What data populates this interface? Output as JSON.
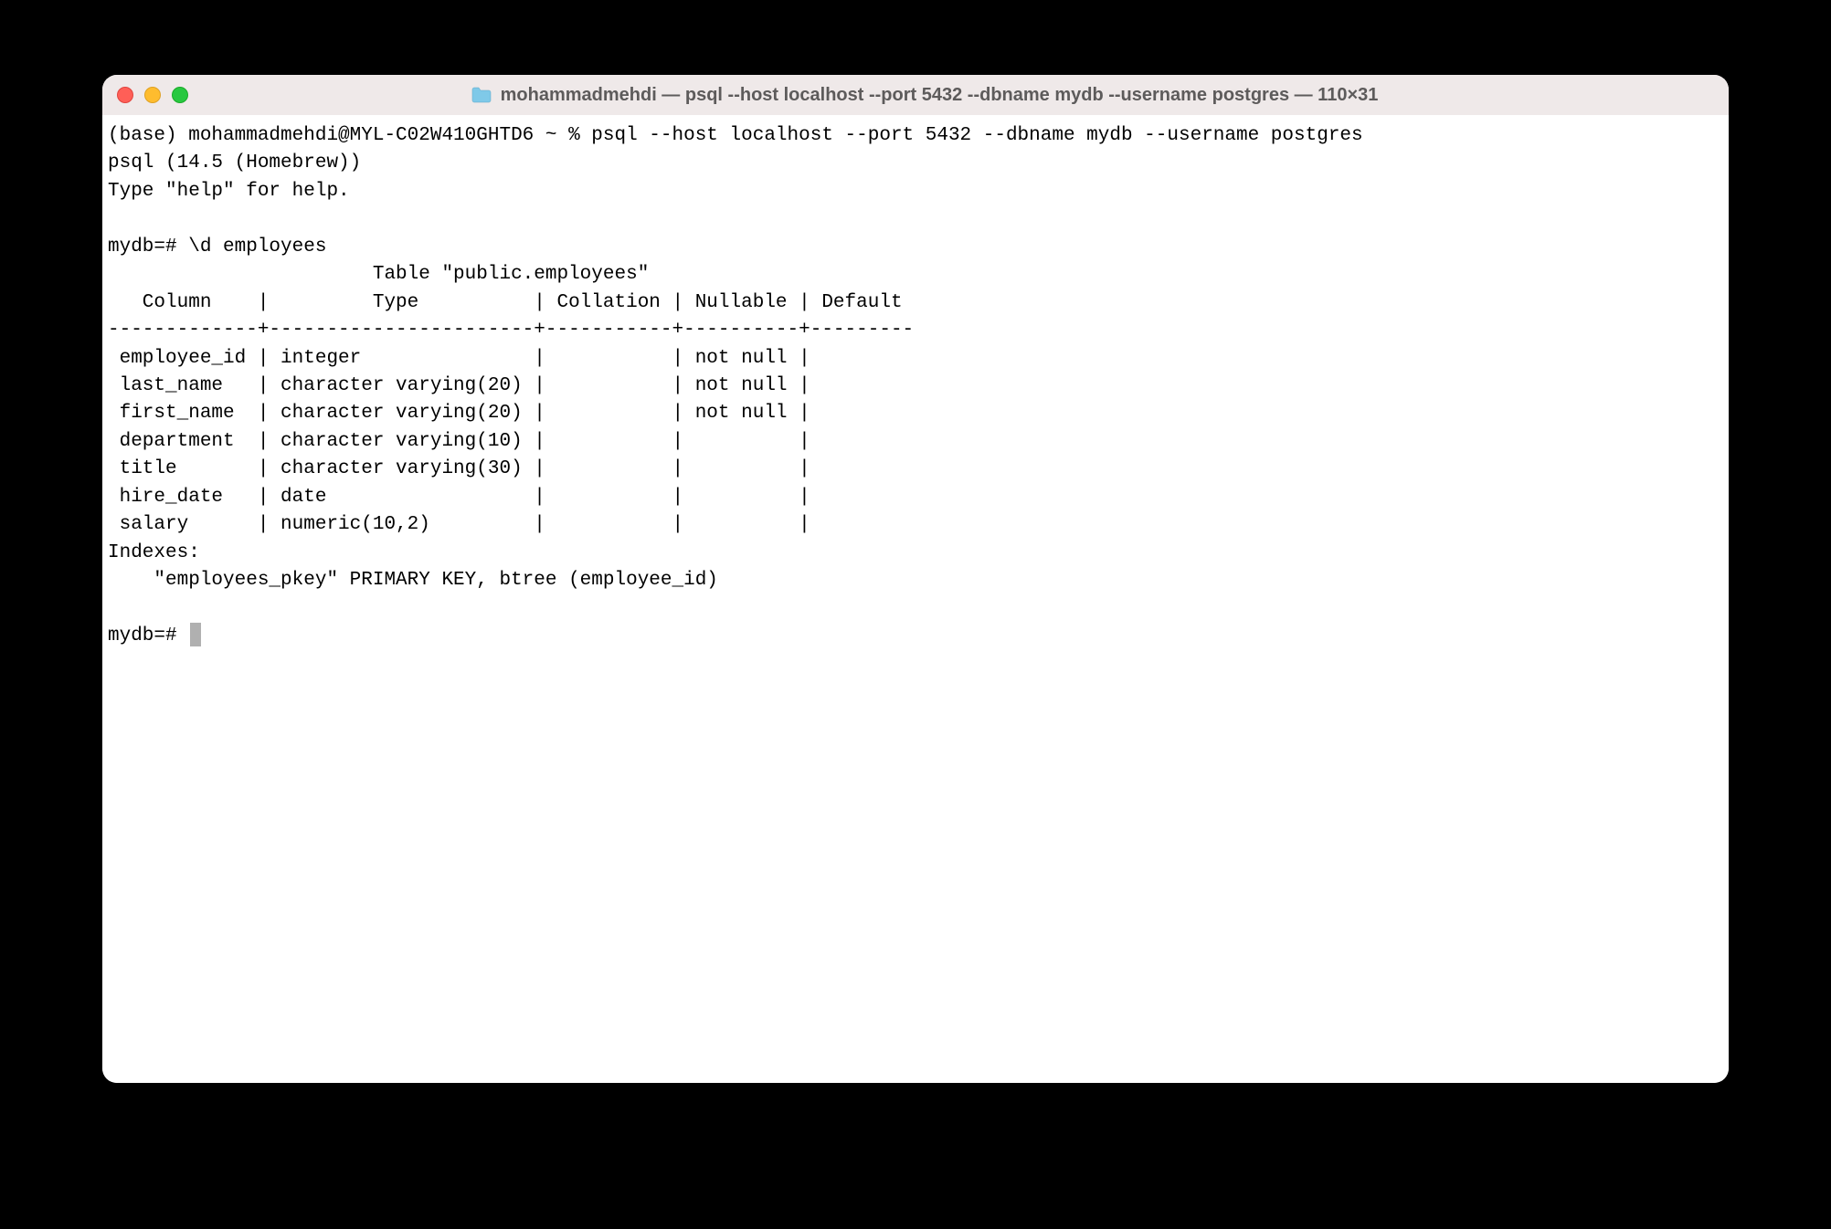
{
  "titlebar": {
    "title": "mohammadmehdi — psql --host localhost --port 5432 --dbname mydb --username postgres — 110×31"
  },
  "terminal": {
    "line_prompt": "(base) mohammadmehdi@MYL-C02W410GHTD6 ~ % psql --host localhost --port 5432 --dbname mydb --username postgres",
    "line_version": "psql (14.5 (Homebrew))",
    "line_help": "Type \"help\" for help.",
    "line_blank1": "",
    "line_cmd": "mydb=# \\d employees",
    "line_table_title": "                       Table \"public.employees\"",
    "line_header": "   Column    |         Type          | Collation | Nullable | Default ",
    "line_sep": "-------------+-----------------------+-----------+----------+---------",
    "line_row1": " employee_id | integer               |           | not null | ",
    "line_row2": " last_name   | character varying(20) |           | not null | ",
    "line_row3": " first_name  | character varying(20) |           | not null | ",
    "line_row4": " department  | character varying(10) |           |          | ",
    "line_row5": " title       | character varying(30) |           |          | ",
    "line_row6": " hire_date   | date                  |           |          | ",
    "line_row7": " salary      | numeric(10,2)         |           |          | ",
    "line_indexes": "Indexes:",
    "line_index1": "    \"employees_pkey\" PRIMARY KEY, btree (employee_id)",
    "line_blank2": "",
    "line_prompt2": "mydb=# "
  }
}
